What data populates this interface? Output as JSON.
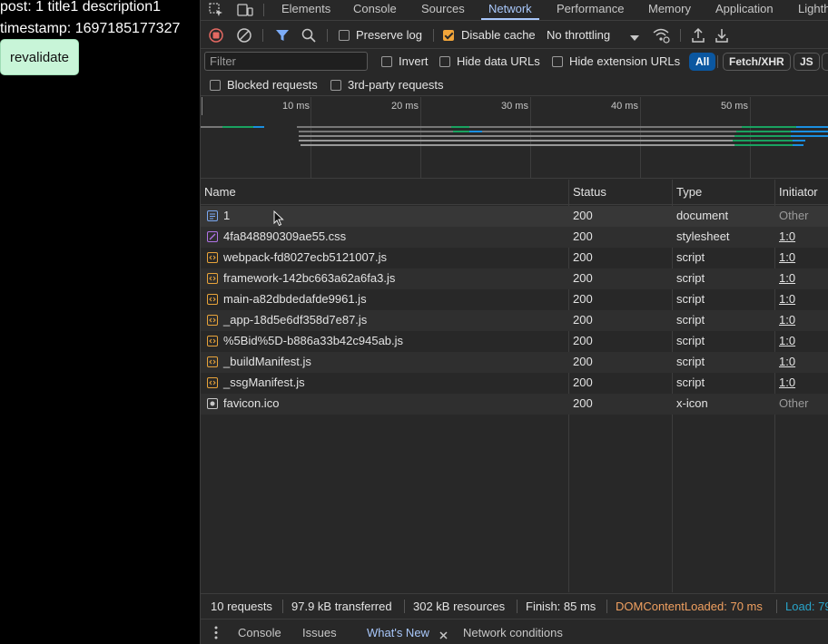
{
  "page": {
    "post_line": "post: 1 title1 description1",
    "timestamp_line": "timestamp: 1697185177327",
    "revalidate_label": "revalidate"
  },
  "devtools": {
    "tabs": [
      "Elements",
      "Console",
      "Sources",
      "Network",
      "Performance",
      "Memory",
      "Application",
      "Lighth"
    ],
    "active_tab": "Network",
    "toolbar": {
      "preserve_log": "Preserve log",
      "disable_cache": "Disable cache",
      "throttling": "No throttling"
    },
    "filter": {
      "placeholder": "Filter",
      "invert": "Invert",
      "hide_data_urls": "Hide data URLs",
      "hide_extension_urls": "Hide extension URLs",
      "types": [
        "All",
        "Fetch/XHR",
        "JS"
      ],
      "blocked_requests": "Blocked requests",
      "third_party": "3rd-party requests"
    },
    "overview": {
      "ticks": [
        "10 ms",
        "20 ms",
        "30 ms",
        "40 ms",
        "50 ms"
      ]
    },
    "table": {
      "columns": [
        "Name",
        "Status",
        "Type",
        "Initiator"
      ],
      "rows": [
        {
          "name": "1",
          "status": "200",
          "type": "document",
          "initiator": "Other",
          "icon": "document-icon"
        },
        {
          "name": "4fa848890309ae55.css",
          "status": "200",
          "type": "stylesheet",
          "initiator": "1:0",
          "icon": "stylesheet-icon"
        },
        {
          "name": "webpack-fd8027ecb5121007.js",
          "status": "200",
          "type": "script",
          "initiator": "1:0",
          "icon": "script-icon"
        },
        {
          "name": "framework-142bc663a62a6fa3.js",
          "status": "200",
          "type": "script",
          "initiator": "1:0",
          "icon": "script-icon"
        },
        {
          "name": "main-a82dbdedafde9961.js",
          "status": "200",
          "type": "script",
          "initiator": "1:0",
          "icon": "script-icon"
        },
        {
          "name": "_app-18d5e6df358d7e87.js",
          "status": "200",
          "type": "script",
          "initiator": "1:0",
          "icon": "script-icon"
        },
        {
          "name": "%5Bid%5D-b886a33b42c945ab.js",
          "status": "200",
          "type": "script",
          "initiator": "1:0",
          "icon": "script-icon"
        },
        {
          "name": "_buildManifest.js",
          "status": "200",
          "type": "script",
          "initiator": "1:0",
          "icon": "script-icon"
        },
        {
          "name": "_ssgManifest.js",
          "status": "200",
          "type": "script",
          "initiator": "1:0",
          "icon": "script-icon"
        },
        {
          "name": "favicon.ico",
          "status": "200",
          "type": "x-icon",
          "initiator": "Other",
          "icon": "image-icon"
        }
      ]
    },
    "status": {
      "requests": "10 requests",
      "transferred": "97.9 kB transferred",
      "resources": "302 kB resources",
      "finish": "Finish: 85 ms",
      "dom_content_loaded": "DOMContentLoaded: 70 ms",
      "load": "Load: 79"
    },
    "drawer": {
      "tabs": [
        "Console",
        "Issues",
        "What's New",
        "Network conditions"
      ],
      "active_tab": "What's New"
    },
    "colors": {
      "accent": "#a8c7fa",
      "dcl": "#f0a060",
      "load": "#29a3c8",
      "script_icon": "#e8a33a",
      "css_icon": "#b073e6",
      "doc_icon": "#7aa7f0"
    }
  }
}
